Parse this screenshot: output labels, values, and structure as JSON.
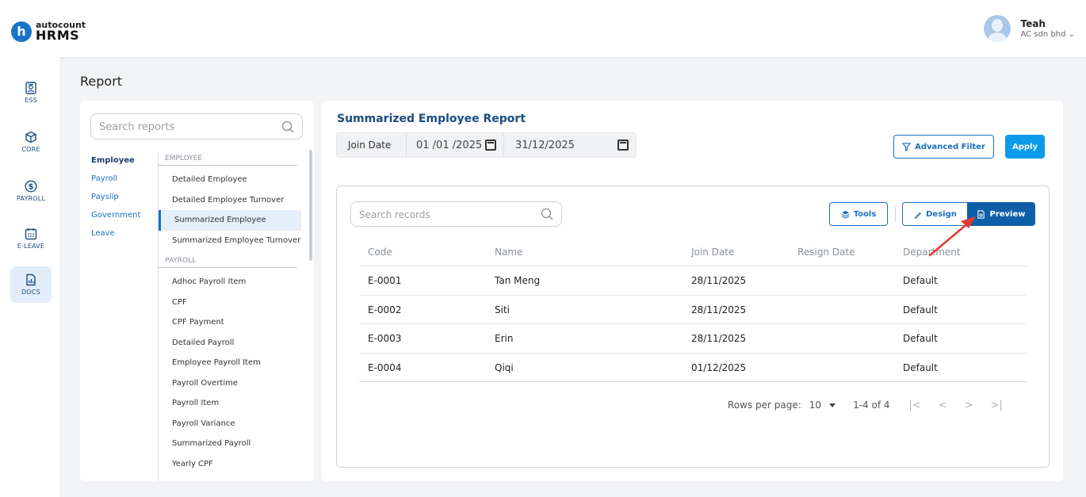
{
  "app": {
    "brand": "autocount",
    "product": "HRMS",
    "user_name": "Teah",
    "user_company": "AC sdn bhd"
  },
  "sidenav": [
    {
      "label": "ESS",
      "icon": "badge-icon"
    },
    {
      "label": "CORE",
      "icon": "cube-icon"
    },
    {
      "label": "PAYROLL",
      "icon": "dollar-icon"
    },
    {
      "label": "E-LEAVE",
      "icon": "calendar-icon"
    },
    {
      "label": "DOCS",
      "icon": "report-doc-icon",
      "active": true
    }
  ],
  "page": {
    "title": "Report"
  },
  "report_list": {
    "search_placeholder": "Search reports",
    "categories": [
      "Employee",
      "Payroll",
      "Payslip",
      "Government",
      "Leave"
    ],
    "active_category": "Employee",
    "sections": [
      {
        "name": "EMPLOYEE",
        "items": [
          "Detailed Employee",
          "Detailed Employee Turnover",
          "Summarized Employee",
          "Summarized Employee Turnover"
        ]
      },
      {
        "name": "PAYROLL",
        "items": [
          "Adhoc Payroll Item",
          "CPF",
          "CPF Payment",
          "Detailed Payroll",
          "Employee Payroll Item",
          "Payroll Overtime",
          "Payroll Item",
          "Payroll Variance",
          "Summarized Payroll",
          "Yearly CPF"
        ]
      }
    ],
    "active_item": "Summarized Employee"
  },
  "report": {
    "title": "Summarized Employee Report",
    "date_label": "Join Date",
    "date_start": "01 /01 /2025",
    "date_end": "31/12/2025",
    "advanced_filter_label": "Advanced Filter",
    "apply_label": "Apply",
    "record_search_placeholder": "Search records",
    "tools_label": "Tools",
    "design_label": "Design",
    "preview_label": "Preview",
    "columns": [
      "Code",
      "Name",
      "Join Date",
      "Resign Date",
      "Department"
    ],
    "rows": [
      {
        "code": "E-0001",
        "name": "Tan Meng",
        "join_date": "28/11/2025",
        "resign_date": "",
        "department": "Default"
      },
      {
        "code": "E-0002",
        "name": "Siti",
        "join_date": "28/11/2025",
        "resign_date": "",
        "department": "Default"
      },
      {
        "code": "E-0003",
        "name": "Erin",
        "join_date": "28/11/2025",
        "resign_date": "",
        "department": "Default"
      },
      {
        "code": "E-0004",
        "name": "Qiqi",
        "join_date": "01/12/2025",
        "resign_date": "",
        "department": "Default"
      }
    ],
    "pagination": {
      "rows_per_page_label": "Rows per page:",
      "rows_per_page": "10",
      "range": "1-4 of 4",
      "first": "|<",
      "prev": "<",
      "next": ">",
      "last": ">|"
    }
  },
  "colors": {
    "primary": "#1a6fbf",
    "apply": "#0b9be8",
    "preview": "#0f5fa8",
    "annotation_arrow": "#e53935"
  }
}
